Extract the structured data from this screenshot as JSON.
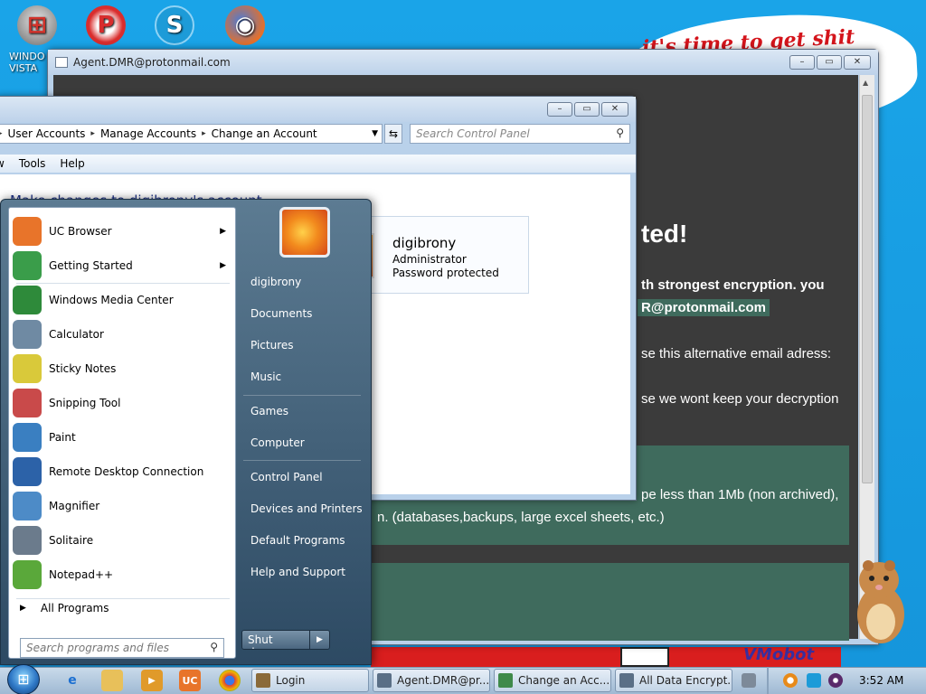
{
  "desktop": {
    "icons": [
      {
        "name": "windows-vista-icon",
        "label": "WINDO VISTA"
      },
      {
        "name": "p-app-icon",
        "label": ""
      },
      {
        "name": "skype-icon",
        "label": ""
      },
      {
        "name": "firefox-icon",
        "label": ""
      }
    ],
    "banner_text": "it's time to get shit",
    "footer_logo_text": "VMobot"
  },
  "ransom_window": {
    "title": "Agent.DMR@protonmail.com",
    "heading": "ted!",
    "line1": "th strongest encryption. you",
    "email": "R@protonmail.com",
    "line2": "se this alternative email adress:",
    "line3": "se we wont keep your decryption",
    "line4": "pe less than 1Mb (non archived),",
    "line5": "n. (databases,backups, large excel sheets, etc.)"
  },
  "control_panel": {
    "breadcrumb": [
      "User Accounts",
      "Manage Accounts",
      "Change an Account"
    ],
    "search_placeholder": "Search Control Panel",
    "menu": [
      "w",
      "Tools",
      "Help"
    ],
    "heading": "Make changes to digibrony's account",
    "account": {
      "name": "digibrony",
      "role": "Administrator",
      "status": "Password protected"
    }
  },
  "start_menu": {
    "programs": [
      {
        "label": "UC Browser",
        "icon": "uc-browser-icon",
        "color": "#e8742a",
        "has_arrow": true
      },
      {
        "label": "Getting Started",
        "icon": "getting-started-icon",
        "color": "#3a9d4a",
        "has_arrow": true
      },
      {
        "label": "Windows Media Center",
        "icon": "windows-media-center-icon",
        "color": "#2e8a3a",
        "has_arrow": false
      },
      {
        "label": "Calculator",
        "icon": "calculator-icon",
        "color": "#6f8aa3",
        "has_arrow": false
      },
      {
        "label": "Sticky Notes",
        "icon": "sticky-notes-icon",
        "color": "#d9c93a",
        "has_arrow": false
      },
      {
        "label": "Snipping Tool",
        "icon": "snipping-tool-icon",
        "color": "#c94a4a",
        "has_arrow": false
      },
      {
        "label": "Paint",
        "icon": "paint-icon",
        "color": "#3a7fc1",
        "has_arrow": false
      },
      {
        "label": "Remote Desktop Connection",
        "icon": "remote-desktop-icon",
        "color": "#2c62a8",
        "has_arrow": false
      },
      {
        "label": "Magnifier",
        "icon": "magnifier-icon",
        "color": "#4d8bc7",
        "has_arrow": false
      },
      {
        "label": "Solitaire",
        "icon": "solitaire-icon",
        "color": "#6b7b8c",
        "has_arrow": false
      },
      {
        "label": "Notepad++",
        "icon": "notepad-plus-plus-icon",
        "color": "#5aa83a",
        "has_arrow": false
      }
    ],
    "all_programs": "All Programs",
    "search_placeholder": "Search programs and files",
    "right_items": [
      "digibrony",
      "Documents",
      "Pictures",
      "Music",
      "Games",
      "Computer",
      "Control Panel",
      "Devices and Printers",
      "Default Programs",
      "Help and Support"
    ],
    "shutdown_label": "Shut down"
  },
  "taskbar": {
    "buttons": [
      {
        "label": "Login",
        "color": "#8a6a3a"
      },
      {
        "label": "Agent.DMR@pr...",
        "color": "#5a6f86"
      },
      {
        "label": "Change an Acc...",
        "color": "#3f8a4a"
      },
      {
        "label": "All Data Encrypt...",
        "color": "#5a6f86"
      }
    ],
    "clock": "3:52 AM"
  }
}
